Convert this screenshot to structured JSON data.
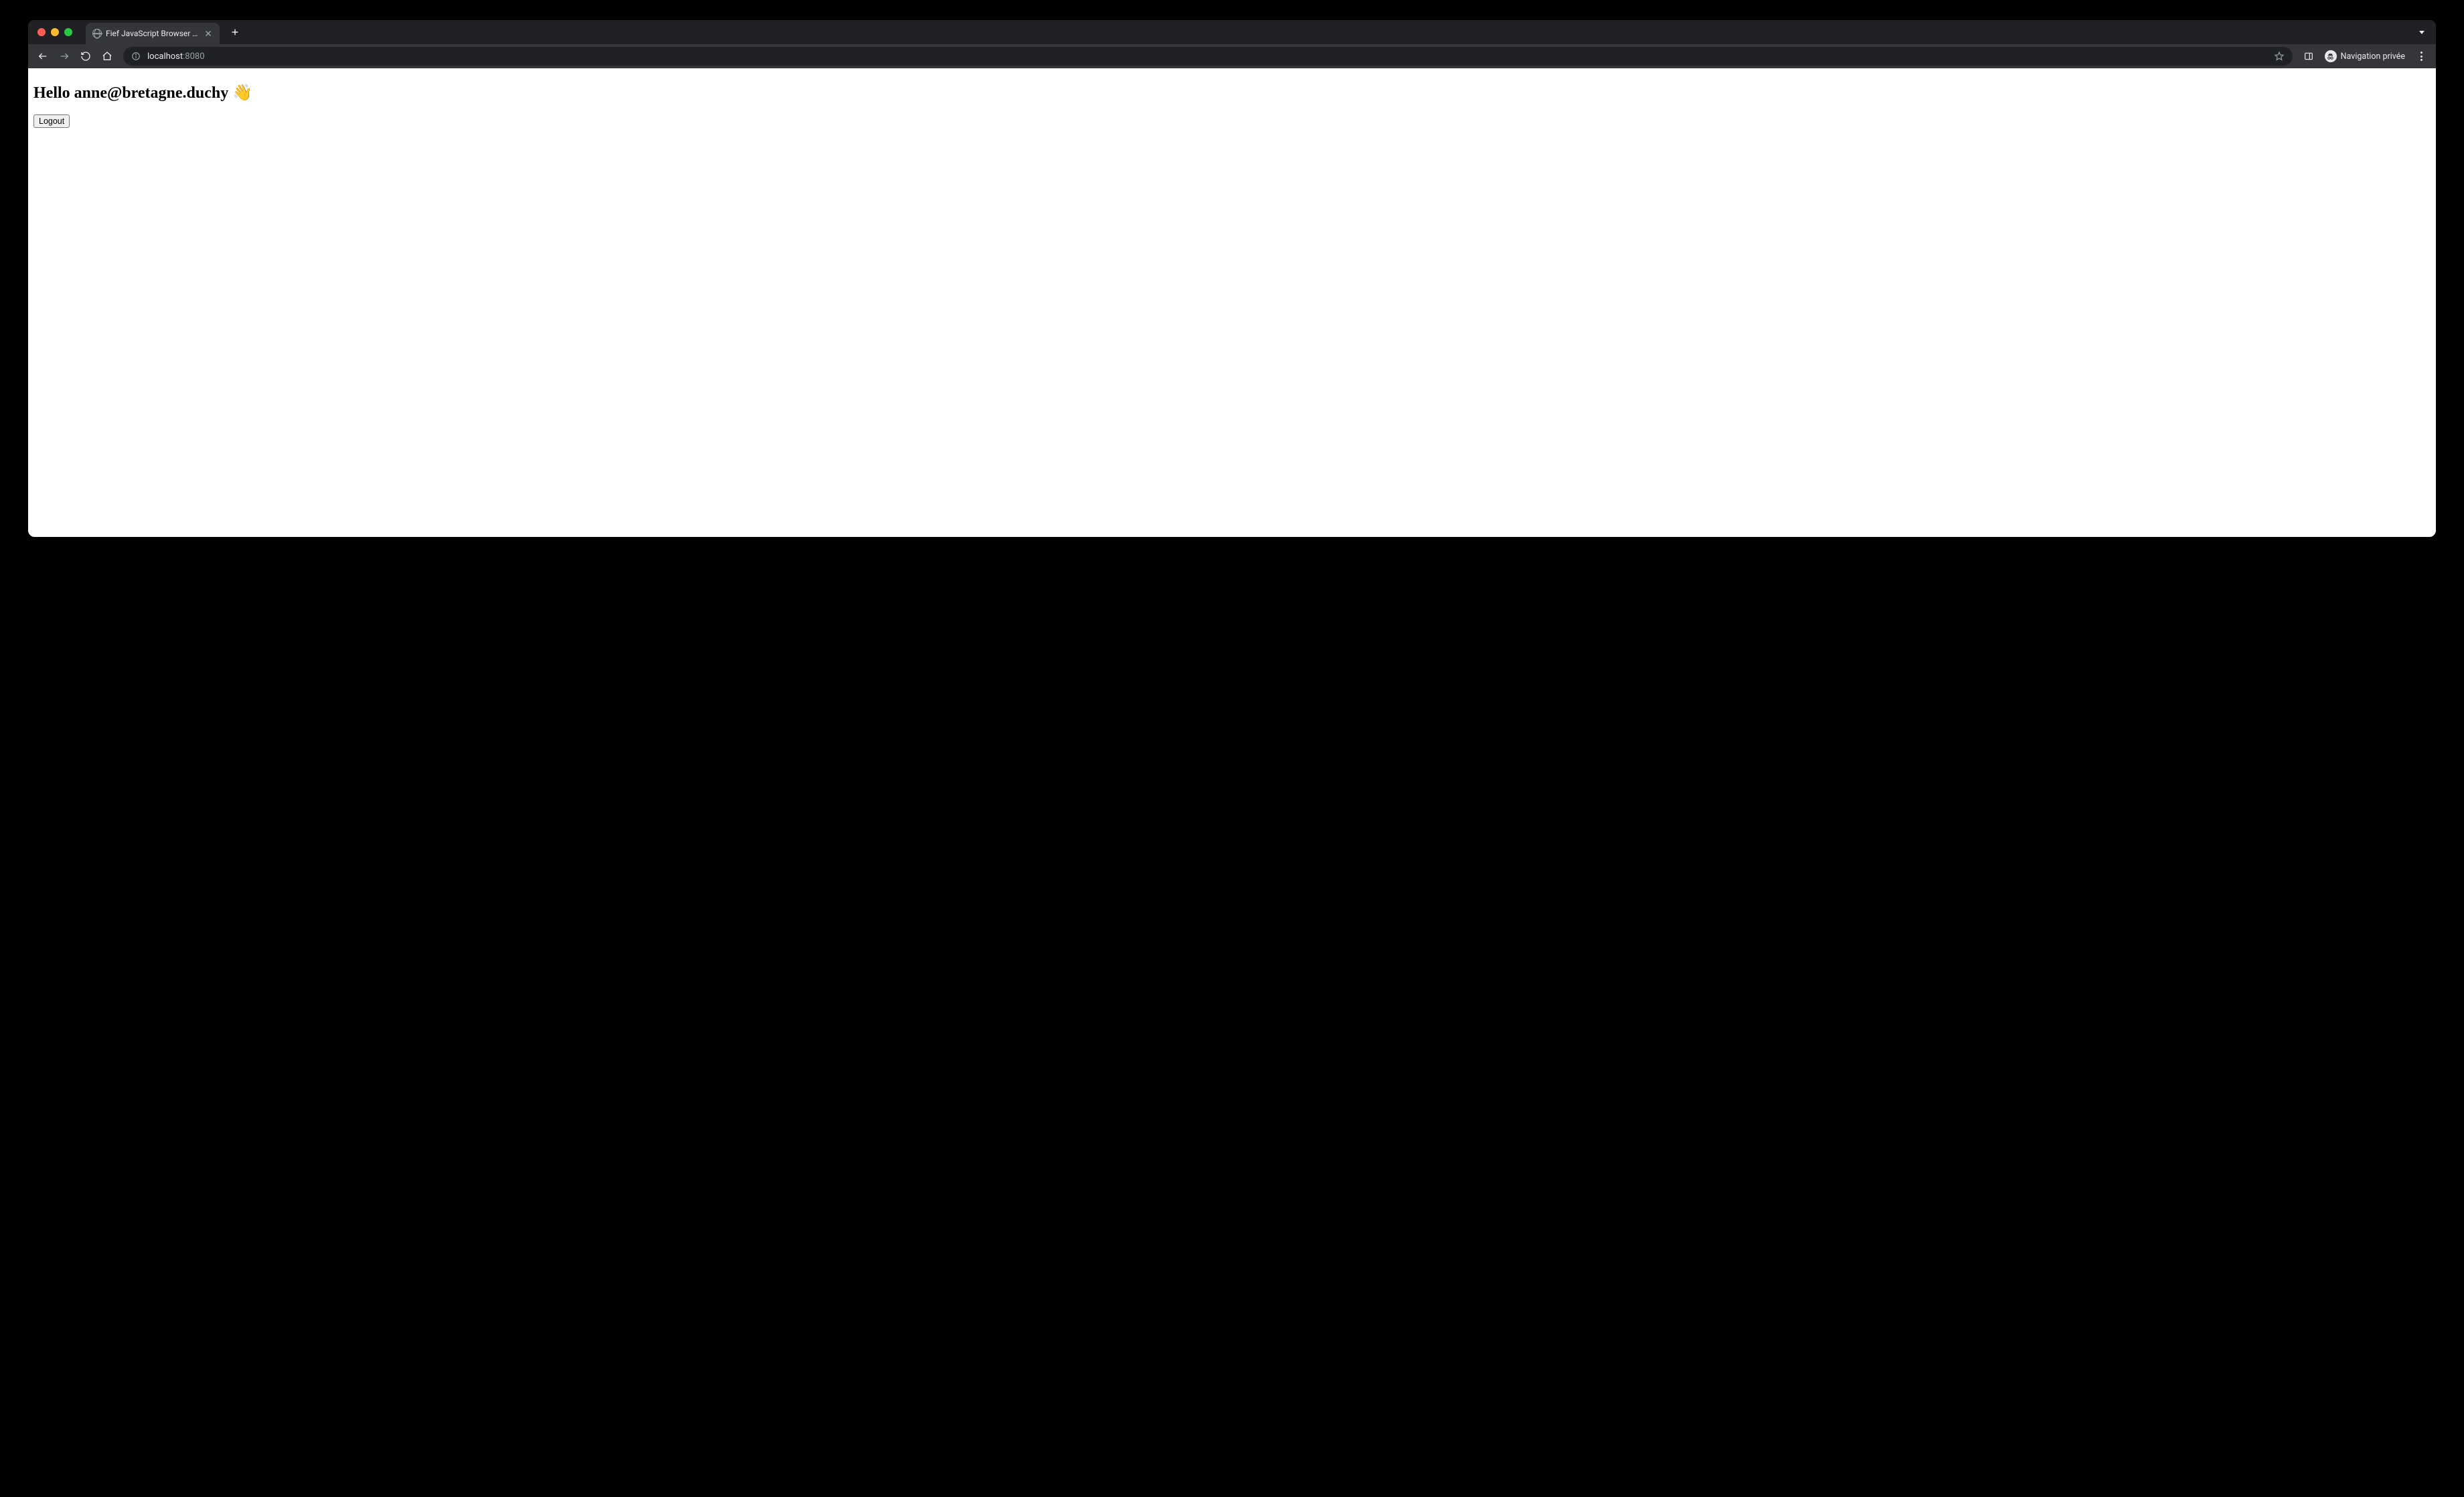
{
  "browser": {
    "tab": {
      "title": "Fief JavaScript Browser examp"
    },
    "address": {
      "host": "localhost",
      "port": ":8080"
    },
    "incognito_label": "Navigation privée"
  },
  "page": {
    "greeting": "Hello anne@bretagne.duchy 👋",
    "logout_label": "Logout"
  }
}
